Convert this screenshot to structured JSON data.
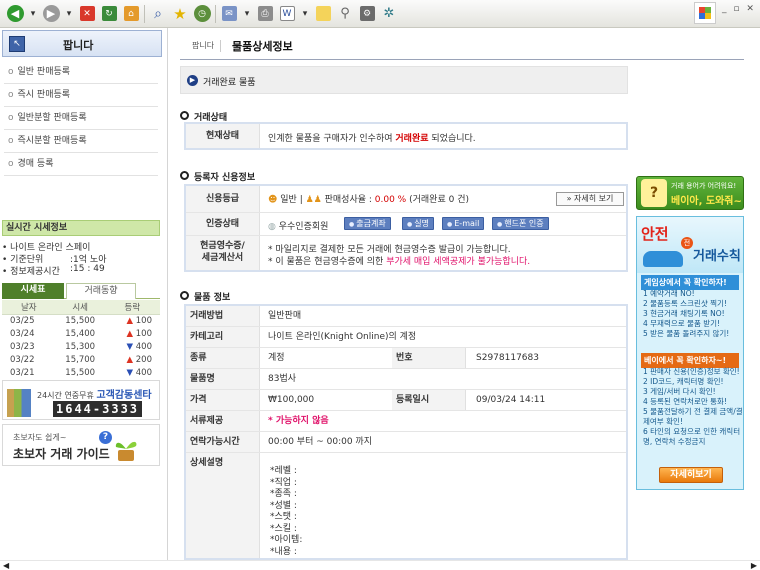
{
  "sidebar": {
    "title": "팝니다",
    "menu": [
      "일반 판매등록",
      "즉시 판매등록",
      "일반분할 판매등록",
      "즉시분할 판매등록",
      "경매 등록"
    ],
    "realtime": {
      "title": "실시간 시세정보",
      "game": "• 나이트 온라인 스페이",
      "unit_label": "• 기준단위",
      "unit_value": "1억 노아",
      "time_label": "• 정보제공시간",
      "time_value": "15 : 49"
    },
    "tabs": [
      "시세표",
      "거래동향"
    ],
    "market_headers": [
      "날자",
      "시세",
      "등락"
    ],
    "market_rows": [
      {
        "date": "03/25",
        "price": "15,500",
        "dir": "up",
        "change": "100"
      },
      {
        "date": "03/24",
        "price": "15,400",
        "dir": "up",
        "change": "100"
      },
      {
        "date": "03/23",
        "price": "15,300",
        "dir": "down",
        "change": "400"
      },
      {
        "date": "03/22",
        "price": "15,700",
        "dir": "up",
        "change": "200"
      },
      {
        "date": "03/21",
        "price": "15,500",
        "dir": "down",
        "change": "400"
      }
    ],
    "banner1": {
      "line1": "24시간 연중무휴",
      "line1b": "고객감동센타",
      "phone": "1644-3333"
    },
    "banner2": {
      "line1": "초보자도 쉽게~",
      "line2": "초보자 거래 가이드"
    }
  },
  "page": {
    "breadcrumb": "팝니다",
    "title": "물품상세정보",
    "status_banner": "거래완료 물품"
  },
  "trade_status": {
    "heading": "거래상태",
    "label": "현재상태",
    "text_pre": "인계한 물품을 구매자가 인수하여",
    "text_hl": "거래완료",
    "text_post": "되었습니다."
  },
  "seller": {
    "heading": "등록자 신용정보",
    "credit_label": "신용등급",
    "credit_grade": "일반",
    "sale_rate_label": "판매성사율 :",
    "sale_rate_value": "0.00 %",
    "sale_rate_note": "(거래완료 0 건)",
    "detail_button": "자세히 보기",
    "auth_label": "인증상태",
    "auth_member": "우수인증회원",
    "auth_tags": [
      "출금계좌",
      "실명",
      "E-mail",
      "핸드폰 인증"
    ],
    "receipt_label1": "현금영수증/",
    "receipt_label2": "세금계산서",
    "receipt_line1": "* 마일리지로 결제한 모든 거래에 현금영수증 발급이 가능합니다.",
    "receipt_line2_pre": "* 이 물품은 현금영수증에 의한",
    "receipt_line2_hl": "부가세 매입 세액공제가 불가능합니다."
  },
  "product": {
    "heading": "물품 정보",
    "trade_type_label": "거래방법",
    "trade_type": "일반판매",
    "category_label": "카테고리",
    "category": "나이트 온라인(Knight Online)의 계정",
    "kind_label": "종류",
    "kind": "계정",
    "number_label": "번호",
    "number": "S2978117683",
    "name_label": "물품명",
    "name": "83법사",
    "price_label": "가격",
    "price": "₩100,000",
    "date_label": "등록일시",
    "date": "09/03/24 14:11",
    "doc_label": "서류제공",
    "doc": "* 가능하지 않음",
    "contact_label": "연락가능시간",
    "contact": "00:00 부터 ~ 00:00 까지",
    "desc_label": "상세설명",
    "desc_lines": [
      "*레벨 :",
      "*직업 :",
      "*종족 :",
      "*성별 :",
      "*스탯 :",
      "*스킬 :",
      "*아이템:",
      "*내용 :"
    ]
  },
  "ads": {
    "ad1_line1": "거래 용어가 어려워요!",
    "ad1_line2": "베이아, 도와줘~",
    "ad2_big1": "안전",
    "ad2_circ": "전",
    "ad2_big2": "거래수칙",
    "ad2_sub1": "게임상에서 꼭 확인하자!",
    "ad2_list1": [
      "1 예약거래 NO!",
      "2 물품등록 스크린샷 찍기!",
      "3 현금거래 채팅기록 NO!",
      "4 무재력으로 물품 받기!",
      "5 받은 물품 돌려주지 않기!"
    ],
    "ad2_sub2": "베이에서 꼭 확인하자~!",
    "ad2_list2": [
      "1 판매자 신용(인증)정보 확인!",
      "2 ID코드, 캐릭터명 확인!",
      "3 게임/서버 다시 확인!",
      "4 등록된 연락처로만 통화!",
      "5 물품전달하기 전 결제 금액/결제여부 확인!",
      "6 타인의 요청으로 인한 캐릭터명, 연락처 수정금지"
    ],
    "ad2_button": "자세히보기"
  },
  "colors": {
    "accent": "#d40000",
    "green_tab": "#4f7f2b",
    "blue_tag": "#5d7fbf"
  }
}
